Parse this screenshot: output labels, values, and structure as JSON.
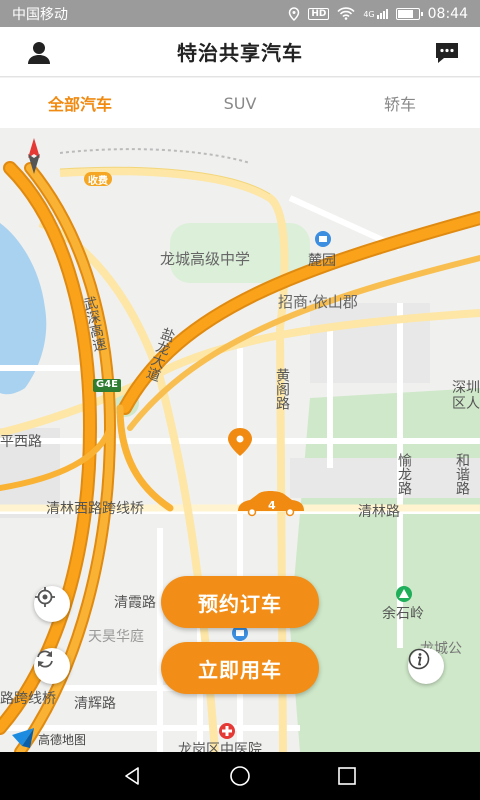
{
  "status_bar": {
    "carrier": "中国移动",
    "network": "4G",
    "hd_badge": "HD",
    "battery_level_percent": 80,
    "time": "08:44"
  },
  "app_bar": {
    "title": "特治共享汽车",
    "left_icon": "user-icon",
    "right_icon": "message-icon"
  },
  "tabs": [
    {
      "label": "全部汽车",
      "active": true
    },
    {
      "label": "SUV",
      "active": false
    },
    {
      "label": "轿车",
      "active": false
    }
  ],
  "map": {
    "labels": {
      "toll": "收费",
      "school": "龙城高级中学",
      "luyuan": "麓园",
      "zhaoshang": "招商·依山郡",
      "wushen": "武深高速",
      "yanlong": "盐龙大道",
      "g4e": "G4E",
      "huangge": "黄阁路",
      "shenzhen": "深圳区人",
      "pingxi": "平西路",
      "yulong": "愉龙路",
      "hexie": "和谐路",
      "qinglin_bridge": "清林西路跨线桥",
      "qinglin": "清林路",
      "qingxia": "清霞路",
      "yushiling": "余石岭",
      "tianhao": "天昊华庭",
      "longcheng_park": "龙城公",
      "kuaxian": "路跨线桥",
      "qinghui": "清辉路",
      "hospital": "龙岗区中医院",
      "amap": "高德地图"
    },
    "car_marker_number": "4"
  },
  "buttons": {
    "reserve": "预约订车",
    "use_now": "立即用车"
  },
  "colors": {
    "accent": "#f08a11",
    "button": "#f28e17",
    "highway": "#f9a21a",
    "status_bar": "#9b9b9b"
  }
}
